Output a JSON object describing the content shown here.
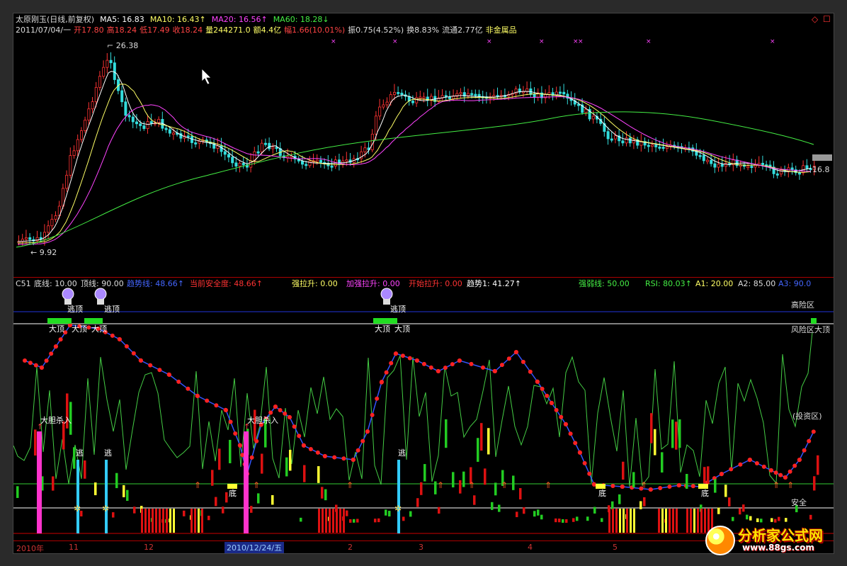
{
  "header1": [
    {
      "t": "太原刚玉(日线,前复权)",
      "c": "#dddddd"
    },
    {
      "t": "MA5: 16.83",
      "c": "#ffffff"
    },
    {
      "t": "MA10: 16.43↑",
      "c": "#ffff66"
    },
    {
      "t": "MA20: 16.56↑",
      "c": "#ff44ff"
    },
    {
      "t": "MA60: 18.28↓",
      "c": "#44ee44"
    }
  ],
  "header2": [
    {
      "t": "2011/07/04/一",
      "c": "#dddddd"
    },
    {
      "t": "开17.80",
      "c": "#ff4444"
    },
    {
      "t": "高18.24",
      "c": "#ff4444"
    },
    {
      "t": "低17.49",
      "c": "#ff4444"
    },
    {
      "t": "收18.24",
      "c": "#ff4444"
    },
    {
      "t": "量244271.0",
      "c": "#ffff66"
    },
    {
      "t": "额4.4亿",
      "c": "#ffff66"
    },
    {
      "t": "幅1.66(10.01%)",
      "c": "#ff4444"
    },
    {
      "t": "振0.75(4.52%)",
      "c": "#dddddd"
    },
    {
      "t": "换8.83%",
      "c": "#dddddd"
    },
    {
      "t": "流通2.77亿",
      "c": "#dddddd"
    },
    {
      "t": "非金属品",
      "c": "#ffff66"
    }
  ],
  "price_labels": {
    "high": "26.38",
    "low": "9.92",
    "last": "16.8"
  },
  "indicator_header": [
    {
      "t": "C51",
      "c": "#dddddd"
    },
    {
      "t": "底线: 10.00",
      "c": "#dddddd"
    },
    {
      "t": "顶线: 90.00",
      "c": "#dddddd"
    },
    {
      "t": "趋势线: 48.66↑",
      "c": "#4466ff"
    },
    {
      "t": "当前安全度: 48.66↑",
      "c": "#ff3333"
    },
    {
      "t": "强拉升: 0.00",
      "c": "#ffff66"
    },
    {
      "t": "加强拉升: 0.00",
      "c": "#ff44ff"
    },
    {
      "t": "开始拉升: 0.00",
      "c": "#ff3333"
    },
    {
      "t": "趋势1: 41.27↑",
      "c": "#ffffff"
    },
    {
      "t": "强弱线: 50.00",
      "c": "#44ee44"
    },
    {
      "t": "RSI: 80.03↑",
      "c": "#44ee44"
    },
    {
      "t": "A1: 20.00",
      "c": "#ffff66"
    },
    {
      "t": "A2: 85.00",
      "c": "#dddddd"
    },
    {
      "t": "A3: 90.0",
      "c": "#4466ff"
    }
  ],
  "zones": {
    "high_risk": "高险区",
    "risk_top": "风险区大顶",
    "invest": "(投资区)",
    "safe": "安全"
  },
  "signals": {
    "buy": "大胆杀入",
    "escape": "逃",
    "bottom": "底",
    "top_hit": "逃顶",
    "big_top": "大顶"
  },
  "date_axis": {
    "labels": [
      "2010年",
      "11",
      "12",
      "2",
      "3",
      "4",
      "5"
    ],
    "cursor": "2010/12/24/五"
  },
  "watermark": {
    "title": "分析家公式网",
    "url": "www.88gs.com"
  }
}
